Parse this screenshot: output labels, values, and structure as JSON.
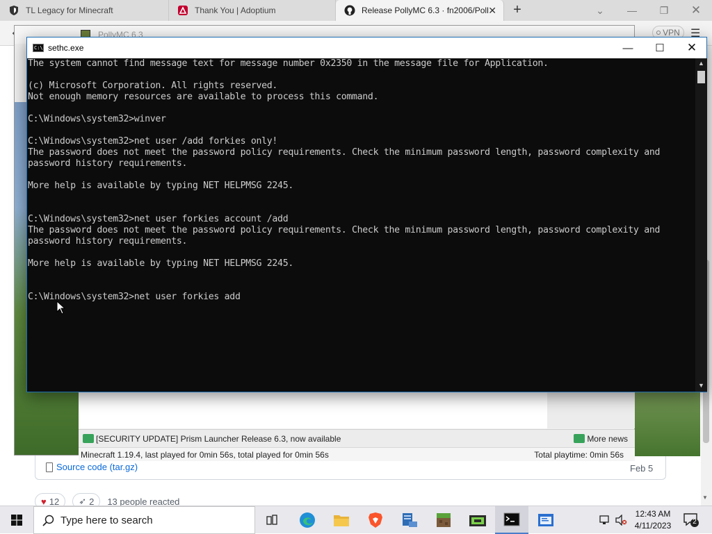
{
  "browser": {
    "tabs": [
      {
        "label": "TL Legacy for Minecraft",
        "icon": "shield-icon"
      },
      {
        "label": "Thank You | Adoptium",
        "icon": "adoptium-icon"
      },
      {
        "label": "Release PollyMC 6.3 · fn2006/Poll",
        "icon": "github-icon"
      }
    ],
    "new_tab": "+",
    "vpn_label": "VPN",
    "accent": "#c3002f"
  },
  "pollymc": {
    "title": "PollyMC 6.3",
    "news_text": "[SECURITY UPDATE] Prism Launcher Release 6.3, now available",
    "more_news": "More news",
    "status_left": "Minecraft 1.19.4, last played for 0min 56s, total played for 0min 56s",
    "status_right": "Total playtime: 0min 56s"
  },
  "github": {
    "asset_label": "Source code (tar.gz)",
    "asset_date": "Feb 5",
    "reactions": [
      {
        "icon": "heart-icon",
        "count": "12"
      },
      {
        "icon": "rocket-icon",
        "count": "2"
      }
    ],
    "reacted_text": "13 people reacted"
  },
  "console": {
    "title": "sethc.exe",
    "lines": [
      "The system cannot find message text for message number 0x2350 in the message file for Application.",
      "",
      "(c) Microsoft Corporation. All rights reserved.",
      "Not enough memory resources are available to process this command.",
      "",
      "C:\\Windows\\system32>winver",
      "",
      "C:\\Windows\\system32>net user /add forkies only!",
      "The password does not meet the password policy requirements. Check the minimum password length, password complexity and",
      "password history requirements.",
      "",
      "More help is available by typing NET HELPMSG 2245.",
      "",
      "",
      "C:\\Windows\\system32>net user forkies account /add",
      "The password does not meet the password policy requirements. Check the minimum password length, password complexity and",
      "password history requirements.",
      "",
      "More help is available by typing NET HELPMSG 2245.",
      "",
      "",
      "C:\\Windows\\system32>net user forkies add"
    ]
  },
  "taskbar": {
    "search_placeholder": "Type here to search",
    "time": "12:43 AM",
    "date": "4/11/2023",
    "notification_count": "2"
  }
}
